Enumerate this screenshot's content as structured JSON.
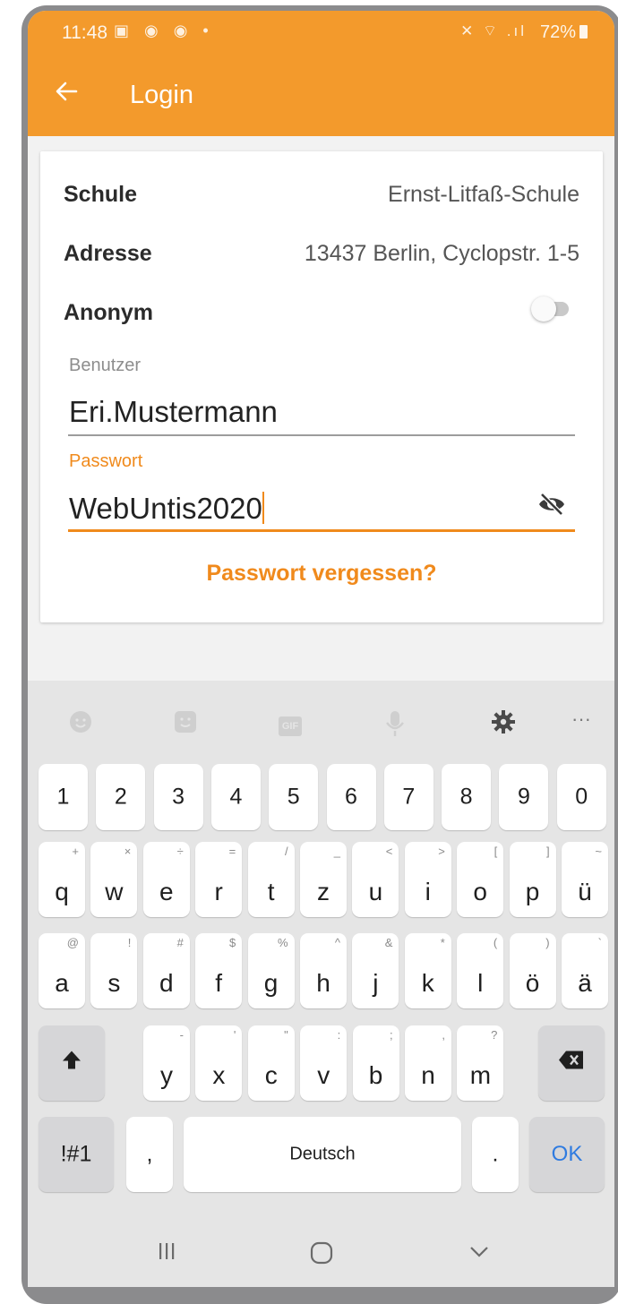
{
  "status_bar": {
    "time": "11:48",
    "left_icons": "▣ ◉ ◉ •",
    "signal": "✕ ⌔ .ıl",
    "battery": "72%"
  },
  "app_bar": {
    "title": "Login"
  },
  "school_info": {
    "school_label": "Schule",
    "school_value": "Ernst-Litfaß-Schule",
    "address_label": "Adresse",
    "address_value": "13437 Berlin, Cyclopstr. 1-5",
    "anonymous_label": "Anonym",
    "anonymous_enabled": false
  },
  "user_field": {
    "label": "Benutzer",
    "value": "Eri.Mustermann"
  },
  "password_field": {
    "label": "Passwort",
    "value": "WebUntis2020",
    "visible": true
  },
  "forgot_password_label": "Passwort vergessen?",
  "keyboard": {
    "language": "Deutsch",
    "toolbar_icons": [
      "emoji-icon",
      "sticker-icon",
      "gif-icon",
      "microphone-icon",
      "gear-icon",
      "more-icon"
    ],
    "gif_label": "GIF",
    "number_row": [
      "1",
      "2",
      "3",
      "4",
      "5",
      "6",
      "7",
      "8",
      "9",
      "0"
    ],
    "row1": [
      {
        "k": "q",
        "h": "+"
      },
      {
        "k": "w",
        "h": "×"
      },
      {
        "k": "e",
        "h": "÷"
      },
      {
        "k": "r",
        "h": "="
      },
      {
        "k": "t",
        "h": "/"
      },
      {
        "k": "z",
        "h": "_"
      },
      {
        "k": "u",
        "h": "<"
      },
      {
        "k": "i",
        "h": ">"
      },
      {
        "k": "o",
        "h": "["
      },
      {
        "k": "p",
        "h": "]"
      },
      {
        "k": "ü",
        "h": "~"
      }
    ],
    "row2": [
      {
        "k": "a",
        "h": "@"
      },
      {
        "k": "s",
        "h": "!"
      },
      {
        "k": "d",
        "h": "#"
      },
      {
        "k": "f",
        "h": "$"
      },
      {
        "k": "g",
        "h": "%"
      },
      {
        "k": "h",
        "h": "^"
      },
      {
        "k": "j",
        "h": "&"
      },
      {
        "k": "k",
        "h": "*"
      },
      {
        "k": "l",
        "h": "("
      },
      {
        "k": "ö",
        "h": ")"
      },
      {
        "k": "ä",
        "h": "`"
      }
    ],
    "row3": [
      {
        "k": "y",
        "h": "-"
      },
      {
        "k": "x",
        "h": "'"
      },
      {
        "k": "c",
        "h": "\""
      },
      {
        "k": "v",
        "h": ":"
      },
      {
        "k": "b",
        "h": ";"
      },
      {
        "k": "n",
        "h": ","
      },
      {
        "k": "m",
        "h": "?"
      }
    ],
    "symbols_label": "!#1",
    "comma_label": ",",
    "period_label": ".",
    "ok_label": "OK"
  },
  "colors": {
    "accent": "#f39a2c",
    "link": "#f08a1c",
    "ok_key": "#2f7be0"
  }
}
